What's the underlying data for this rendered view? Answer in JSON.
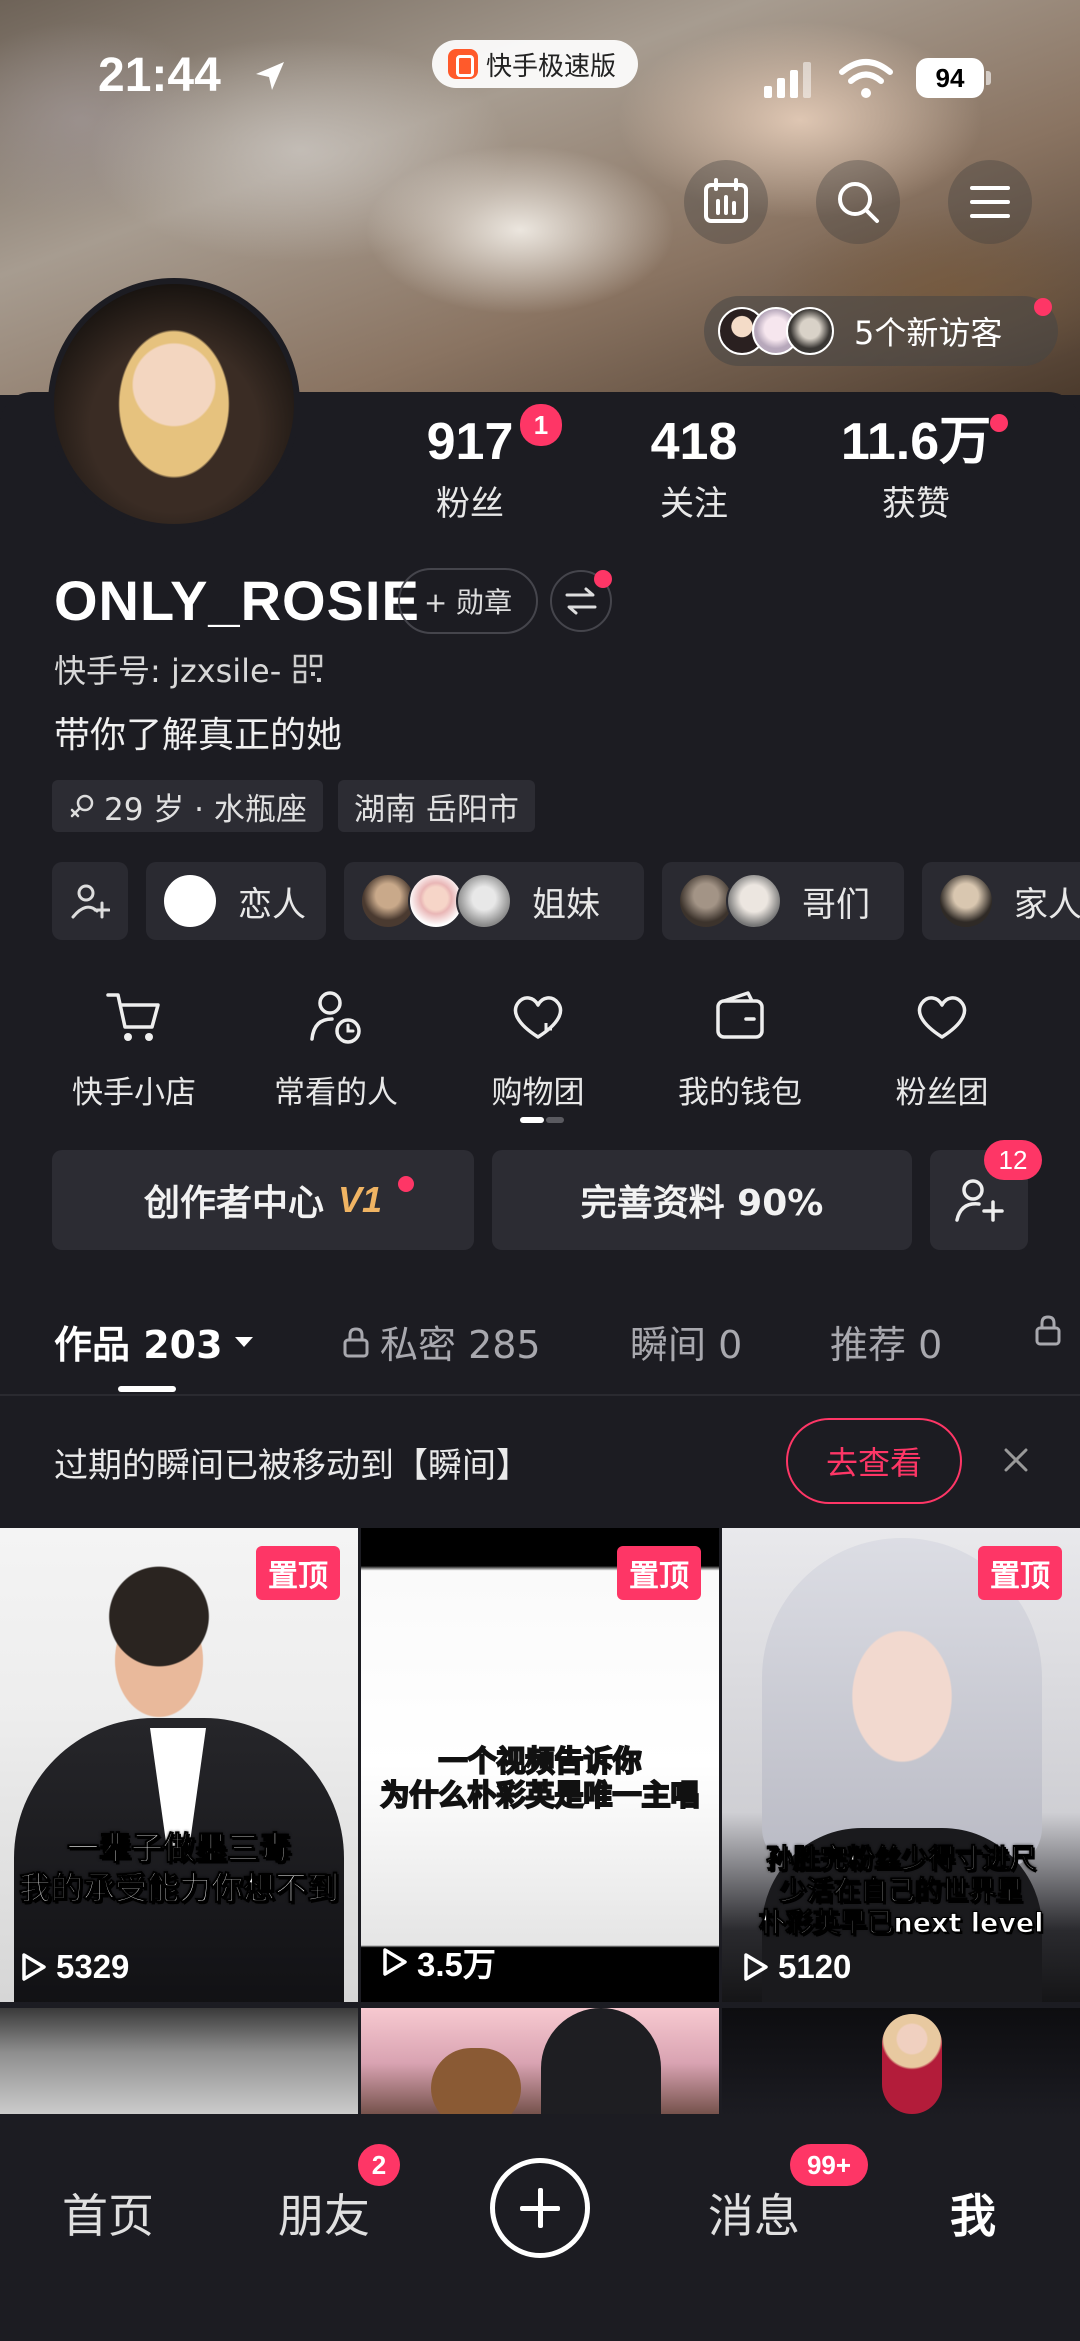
{
  "status_bar": {
    "time": "21:44",
    "app_name": "快手极速版",
    "battery": "94"
  },
  "visitors": {
    "label": "5个新访客"
  },
  "stats": [
    {
      "value": "917",
      "label": "粉丝",
      "badge": "1"
    },
    {
      "value": "418",
      "label": "关注"
    },
    {
      "value": "11.6万",
      "label": "获赞"
    }
  ],
  "profile": {
    "name": "ONLY_ROSIE",
    "medal_label": "+ 勋章",
    "kuaishou_id": "快手号: jzxsile-",
    "bio": "带你了解真正的她",
    "tags": [
      "29 岁 · 水瓶座",
      "湖南 岳阳市"
    ]
  },
  "relations": [
    {
      "label": "恋人"
    },
    {
      "label": "姐妹"
    },
    {
      "label": "哥们"
    },
    {
      "label": "家人"
    }
  ],
  "quick_actions": [
    {
      "label": "快手小店",
      "icon": "cart-icon"
    },
    {
      "label": "常看的人",
      "icon": "user-clock-icon"
    },
    {
      "label": "购物团",
      "icon": "heart-bag-icon"
    },
    {
      "label": "我的钱包",
      "icon": "wallet-icon"
    },
    {
      "label": "粉丝团",
      "icon": "heart-icon"
    }
  ],
  "buttons": {
    "creator_center": "创作者中心",
    "creator_level": "V1",
    "complete_profile": "完善资料 90%",
    "add_friend_badge": "12"
  },
  "tabs": [
    {
      "label": "作品 203"
    },
    {
      "label": "私密 285"
    },
    {
      "label": "瞬间 0"
    },
    {
      "label": "推荐 0"
    }
  ],
  "notice": {
    "text": "过期的瞬间已被移动到【瞬间】",
    "action": "去查看"
  },
  "videos": [
    {
      "pinned": "置顶",
      "views": "5329",
      "caption_line1": "一辈子做墨三毒",
      "caption_line2": "我的承受能力你想不到"
    },
    {
      "pinned": "置顶",
      "views": "3.5万",
      "caption_line1": "一个视频告诉你",
      "caption_line2": "为什么朴彩英是唯一主唱"
    },
    {
      "pinned": "置顶",
      "views": "5120",
      "caption_line1": "孙胜完粉丝少得寸进尺",
      "caption_line2": "少活在自己的世界里",
      "caption_line3": "朴彩英早已next level"
    }
  ],
  "bottom_nav": {
    "home": "首页",
    "friends": "朋友",
    "friends_badge": "2",
    "messages": "消息",
    "messages_badge": "99+",
    "me": "我"
  },
  "colors": {
    "accent": "#fe3666",
    "background": "#1c1c22",
    "level_gold": "#f0b463"
  }
}
